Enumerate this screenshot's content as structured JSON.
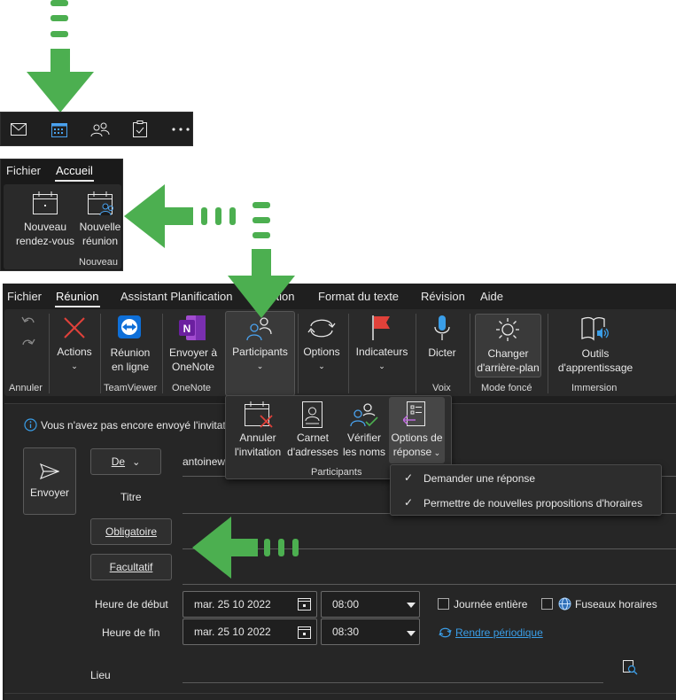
{
  "navbar": {
    "items": [
      "mail-icon",
      "calendar-icon",
      "people-icon",
      "tasks-icon",
      "more-icon"
    ]
  },
  "home_ribbon": {
    "tabs": [
      "Fichier",
      "Accueil"
    ],
    "buttons": [
      {
        "line1": "Nouveau",
        "line2": "rendez-vous"
      },
      {
        "line1": "Nouvelle",
        "line2": "réunion"
      }
    ],
    "group_label": "Nouveau"
  },
  "meeting_ribbon": {
    "tabs": [
      "Fichier",
      "Réunion",
      "Assistant Planification",
      "ertion",
      "Format du texte",
      "Révision",
      "Aide"
    ],
    "buttons": {
      "actions": "Actions",
      "teamviewer_1": "Réunion",
      "teamviewer_2": "en ligne",
      "onenote_1": "Envoyer à",
      "onenote_2": "OneNote",
      "participants": "Participants",
      "options": "Options",
      "indicateurs": "Indicateurs",
      "dicter": "Dicter",
      "changer_1": "Changer",
      "changer_2": "d'arrière-plan",
      "outils_1": "Outils",
      "outils_2": "d'apprentissage"
    },
    "groups": {
      "annuler": "Annuler",
      "teamviewer": "TeamViewer",
      "onenote": "OneNote",
      "voix": "Voix",
      "mode_fonce": "Mode foncé",
      "immersion": "Immersion"
    }
  },
  "participants_popup": {
    "buttons": [
      {
        "line1": "Annuler",
        "line2": "l'invitation"
      },
      {
        "line1": "Carnet",
        "line2": "d'adresses"
      },
      {
        "line1": "Vérifier",
        "line2": "les noms"
      },
      {
        "line1": "Options de",
        "line2": "réponse"
      }
    ],
    "group_label": "Participants"
  },
  "response_menu": {
    "items": [
      "Demander une réponse",
      "Permettre de nouvelles propositions d'horaires"
    ]
  },
  "form": {
    "info": "Vous n'avez pas encore envoyé l'invitatio",
    "send": "Envoyer",
    "from": "De",
    "from_value": "antoinew",
    "title": "Titre",
    "required": "Obligatoire",
    "optional": "Facultatif",
    "start_label": "Heure de début",
    "end_label": "Heure de fin",
    "start_date": "mar. 25 10 2022",
    "start_time": "08:00",
    "end_date": "mar. 25 10 2022",
    "end_time": "08:30",
    "all_day": "Journée entière",
    "timezones": "Fuseaux horaires",
    "recurring": "Rendre périodique",
    "location": "Lieu"
  },
  "colors": {
    "arrow_green": "#4caf50",
    "dark_bg": "#1f1f1f",
    "accent_blue": "#3a9ee8"
  }
}
